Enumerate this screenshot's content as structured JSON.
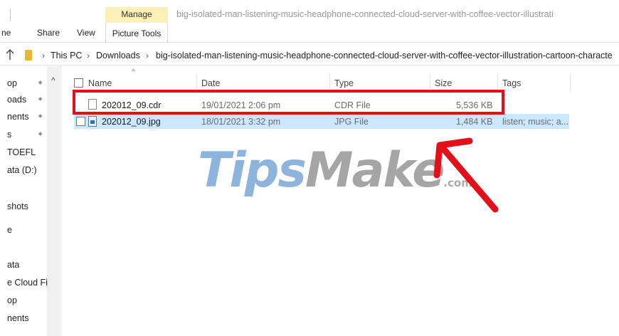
{
  "ribbon": {
    "tabs": [
      "ne",
      "Share",
      "View",
      "Picture Tools"
    ],
    "manage_label": "Manage",
    "window_title": "big-isolated-man-listening-music-headphone-connected-cloud-server-with-coffee-vector-illustrati"
  },
  "address": {
    "crumbs": [
      "This PC",
      "Downloads",
      "big-isolated-man-listening-music-headphone-connected-cloud-server-with-coffee-vector-illustration-cartoon-characte"
    ]
  },
  "nav": {
    "items": [
      "op",
      "oads",
      "nents",
      "s",
      "TOEFL",
      "ata (D:)",
      "shots",
      "e",
      "ata",
      "e Cloud Fi",
      "op",
      "nents"
    ]
  },
  "columns": {
    "name": "Name",
    "date": "Date",
    "type": "Type",
    "size": "Size",
    "tags": "Tags"
  },
  "files": [
    {
      "name": "202012_09.cdr",
      "date": "19/01/2021 2:06 pm",
      "type": "CDR File",
      "size": "5,536 KB",
      "tags": ""
    },
    {
      "name": "202012_09.jpg",
      "date": "18/01/2021 3:32 pm",
      "type": "JPG File",
      "size": "1,484 KB",
      "tags": "listen; music; a..."
    }
  ],
  "watermark": {
    "part1": "Tips",
    "part2": "Make",
    "suffix": ".com"
  },
  "colors": {
    "highlight": "#e3101a",
    "selection": "#cce8ff",
    "manage_tab": "#fbf0b6",
    "folder": "#e8b73a"
  }
}
